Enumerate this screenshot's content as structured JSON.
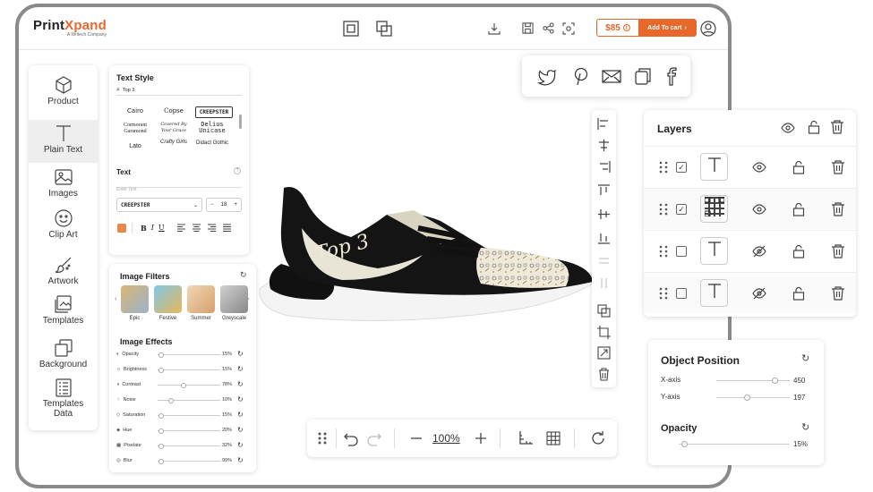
{
  "brand": {
    "name_part1": "Print",
    "name_part2": "Xpand",
    "tagline": "A Writech Company",
    "accent_color": "#e8672a"
  },
  "header": {
    "price": "$85",
    "add_to_cart": "Add To cart",
    "info_icon": "info-icon",
    "chevron": "›"
  },
  "sidebar": {
    "items": [
      {
        "label": "Product",
        "icon": "cube-icon"
      },
      {
        "label": "Plain Text",
        "icon": "text-t-icon"
      },
      {
        "label": "Images",
        "icon": "image-icon"
      },
      {
        "label": "Clip Art",
        "icon": "smiley-icon"
      },
      {
        "label": "Artwork",
        "icon": "brush-icon"
      },
      {
        "label": "Templates",
        "icon": "templates-icon"
      },
      {
        "label": "Background",
        "icon": "layers-icon"
      },
      {
        "label": "Templates Data",
        "icon": "list-icon"
      }
    ]
  },
  "text_style": {
    "title": "Text Style",
    "search_value": "Top 3",
    "fonts": [
      "Cairo",
      "Copse",
      "CREEPSTER",
      "Cormorant Garamond",
      "Covered By Your Grace",
      "Delius Unicase",
      "Lato",
      "Crafty Girls",
      "Didact Gothic"
    ],
    "text_label": "Text",
    "text_placeholder": "Enter Text",
    "font_select": "CREEPSTER",
    "font_size": "18",
    "minus": "−",
    "plus": "+",
    "format_buttons": [
      "B",
      "I",
      "U"
    ]
  },
  "image_filters": {
    "title": "Image Filters",
    "filters": [
      "Epic",
      "Festive",
      "Summer",
      "Greyscale"
    ],
    "effects_title": "Image Effects",
    "effects": [
      {
        "label": "Opacity",
        "value": "15%",
        "level": 0.05
      },
      {
        "label": "Brightness",
        "value": "15%",
        "level": 0.05
      },
      {
        "label": "Contrast",
        "value": "78%",
        "level": 0.42
      },
      {
        "label": "Noise",
        "value": "10%",
        "level": 0.22
      },
      {
        "label": "Saturation",
        "value": "15%",
        "level": 0.05
      },
      {
        "label": "Hue",
        "value": "20%",
        "level": 0.05
      },
      {
        "label": "Pixelate",
        "value": "32%",
        "level": 0.05
      },
      {
        "label": "Blur",
        "value": "99%",
        "level": 0.05
      }
    ]
  },
  "canvas": {
    "shoe_text": "Top 3"
  },
  "bottom_toolbar": {
    "zoom": "100%"
  },
  "layers": {
    "title": "Layers",
    "rows": [
      {
        "type": "text",
        "checked": true,
        "visible": true
      },
      {
        "type": "qr",
        "checked": true,
        "visible": true
      },
      {
        "type": "text",
        "checked": false,
        "visible": false
      },
      {
        "type": "text",
        "checked": false,
        "visible": false
      }
    ]
  },
  "object_position": {
    "title": "Object Position",
    "x_label": "X-axis",
    "x_value": "450",
    "x_level": 0.8,
    "y_label": "Y-axis",
    "y_value": "197",
    "y_level": 0.42,
    "opacity_title": "Opacity",
    "opacity_value": "15%",
    "opacity_level": 0.05
  }
}
